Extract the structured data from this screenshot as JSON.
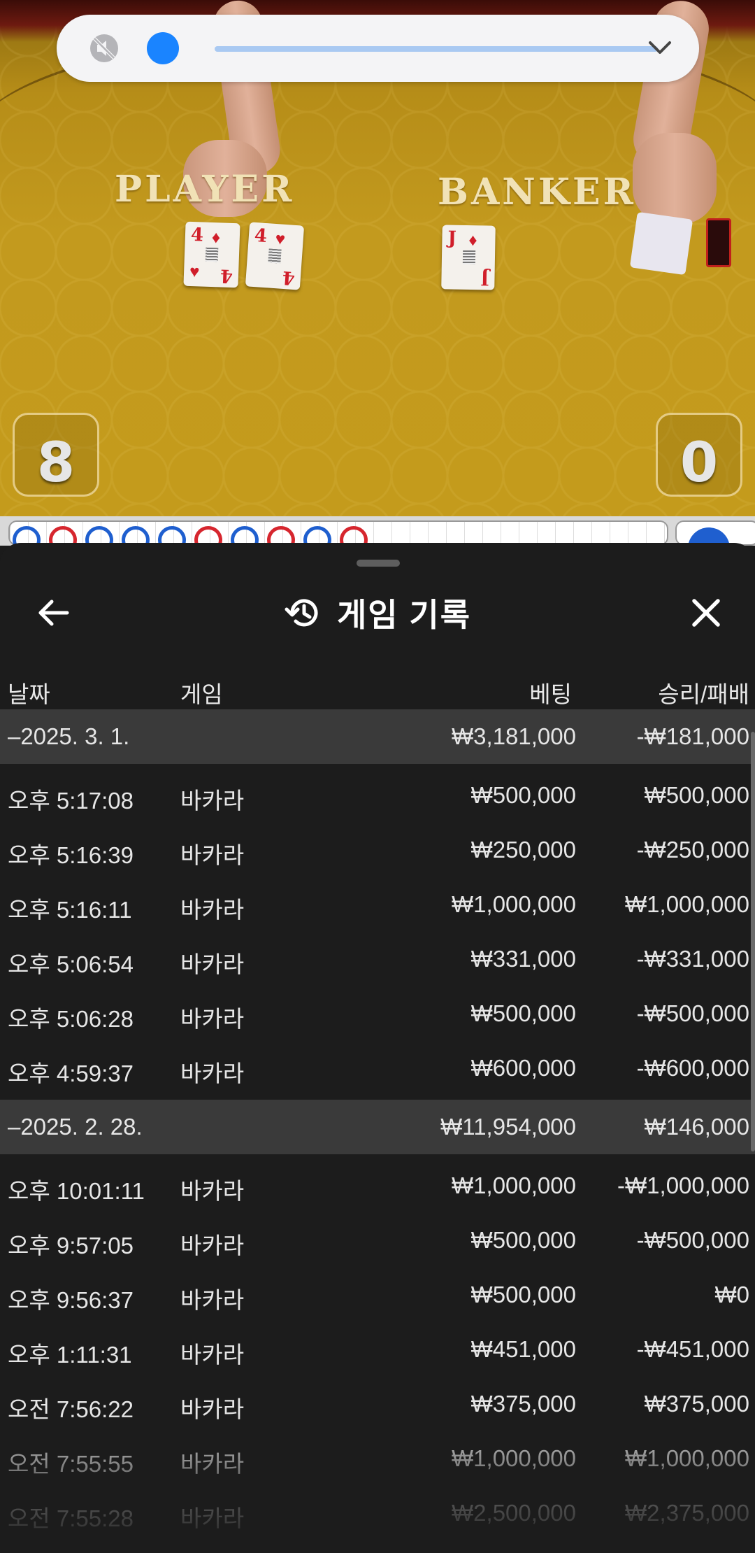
{
  "video": {
    "player_label": "PLAYER",
    "banker_label": "BANKER",
    "player_score": "8",
    "banker_score": "0",
    "player_cards": [
      {
        "rank": "4",
        "suit": "♦"
      },
      {
        "rank": "4",
        "suit": "♥"
      }
    ],
    "banker_cards": [
      {
        "rank": "J",
        "suit": "♦"
      }
    ]
  },
  "volume": {
    "level": 0.0,
    "icon": "volume-muted-icon",
    "expand_icon": "chevron-down-icon",
    "thumb_color": "#1a84ff",
    "track_color": "#a9c9f2"
  },
  "roadmap": {
    "colors": {
      "player": "#1f5fcf",
      "banker": "#d6262e",
      "natural_mark": "#1e9a3a"
    }
  },
  "sheet": {
    "title": "게임 기록",
    "title_icon": "history-icon",
    "back_icon": "arrow-left-icon",
    "close_icon": "close-icon",
    "columns": {
      "date": "날짜",
      "game": "게임",
      "bet": "베팅",
      "result": "승리/패배"
    },
    "groups": [
      {
        "date": "–2025. 3. 1.",
        "total_bet": "₩3,181,000",
        "total_result": "-₩181,000",
        "rows": [
          {
            "time": "오후 5:17:08",
            "game": "바카라",
            "bet": "₩500,000",
            "result": "₩500,000"
          },
          {
            "time": "오후 5:16:39",
            "game": "바카라",
            "bet": "₩250,000",
            "result": "-₩250,000"
          },
          {
            "time": "오후 5:16:11",
            "game": "바카라",
            "bet": "₩1,000,000",
            "result": "₩1,000,000"
          },
          {
            "time": "오후 5:06:54",
            "game": "바카라",
            "bet": "₩331,000",
            "result": "-₩331,000"
          },
          {
            "time": "오후 5:06:28",
            "game": "바카라",
            "bet": "₩500,000",
            "result": "-₩500,000"
          },
          {
            "time": "오후 4:59:37",
            "game": "바카라",
            "bet": "₩600,000",
            "result": "-₩600,000"
          }
        ]
      },
      {
        "date": "–2025. 2. 28.",
        "total_bet": "₩11,954,000",
        "total_result": "₩146,000",
        "rows": [
          {
            "time": "오후 10:01:11",
            "game": "바카라",
            "bet": "₩1,000,000",
            "result": "-₩1,000,000"
          },
          {
            "time": "오후 9:57:05",
            "game": "바카라",
            "bet": "₩500,000",
            "result": "-₩500,000"
          },
          {
            "time": "오후 9:56:37",
            "game": "바카라",
            "bet": "₩500,000",
            "result": "₩0"
          },
          {
            "time": "오후 1:11:31",
            "game": "바카라",
            "bet": "₩451,000",
            "result": "-₩451,000"
          },
          {
            "time": "오전 7:56:22",
            "game": "바카라",
            "bet": "₩375,000",
            "result": "₩375,000"
          },
          {
            "time": "오전 7:55:55",
            "game": "바카라",
            "bet": "₩1,000,000",
            "result": "₩1,000,000"
          },
          {
            "time": "오전 7:55:28",
            "game": "바카라",
            "bet": "₩2,500,000",
            "result": "₩2,375,000"
          }
        ]
      }
    ]
  }
}
